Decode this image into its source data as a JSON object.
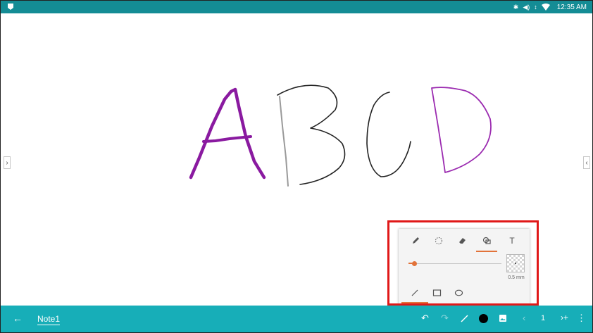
{
  "status_bar": {
    "time": "12:35 AM",
    "icons": [
      "notification-icon",
      "bluetooth-icon",
      "volume-icon",
      "data-arrows-icon",
      "wifi-icon"
    ]
  },
  "side_handles": {
    "left": "›",
    "right": "‹"
  },
  "canvas": {
    "strokes": [
      {
        "letter": "A",
        "color": "#8a1aa0"
      },
      {
        "letter": "B",
        "color": "#222222"
      },
      {
        "letter": "C",
        "color": "#222222"
      },
      {
        "letter": "D",
        "color": "#9b2bb0"
      }
    ]
  },
  "toolbox": {
    "tools": [
      "pen-icon",
      "lasso-icon",
      "eraser-icon",
      "shape-icon",
      "text-icon"
    ],
    "active_tool": "shape-icon",
    "text_tool_glyph": "T",
    "pen_size_label": "0.5 mm",
    "pen_size_fraction": 0.06,
    "shapes": [
      "line-icon",
      "rectangle-icon",
      "ellipse-icon"
    ],
    "active_shape": "line-icon",
    "accent": "#e2733a"
  },
  "bottom_bar": {
    "note_name": "Note1",
    "page_number": "1",
    "pen_color": "#000000",
    "bar_color": "#17aeb8"
  }
}
